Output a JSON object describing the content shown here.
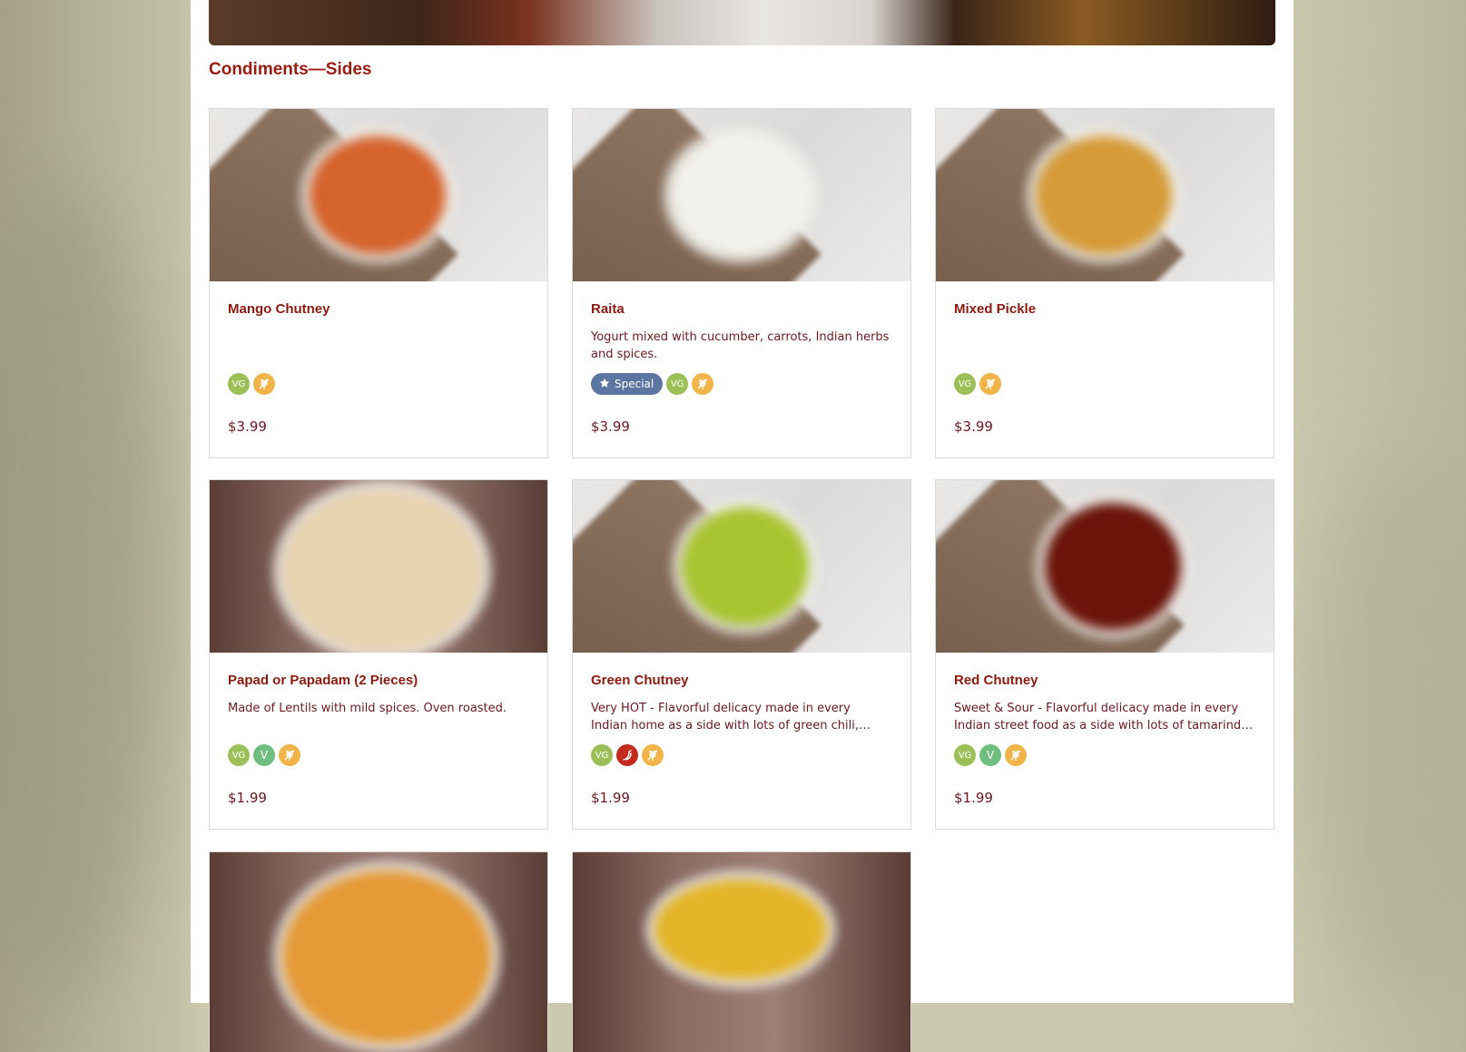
{
  "section": {
    "title": "Condiments—Sides"
  },
  "colors": {
    "accent": "#9a1c10",
    "text": "#6b1820",
    "special": "#5b76a1",
    "vegan": "#9cc057",
    "vegetarian": "#6fbe7f",
    "gluten_free": "#f0b449",
    "hot": "#c22a1e"
  },
  "special_badge": {
    "label": "Special",
    "icon": "star-icon"
  },
  "items": [
    {
      "name": "Mango Chutney",
      "description": "",
      "price": "$3.99",
      "badges": [
        {
          "type": "vg",
          "label": "VG",
          "icon": "vegan-icon"
        },
        {
          "type": "gf",
          "icon": "gluten-free-icon"
        }
      ],
      "image_color": "#d5632c"
    },
    {
      "name": "Raita",
      "description": "Yogurt mixed with cucumber, carrots, Indian herbs and spices.",
      "price": "$3.99",
      "special": true,
      "badges": [
        {
          "type": "vg",
          "label": "VG",
          "icon": "vegan-icon"
        },
        {
          "type": "gf",
          "icon": "gluten-free-icon"
        }
      ],
      "image_color": "#f2f2ec"
    },
    {
      "name": "Mixed Pickle",
      "description": "",
      "price": "$3.99",
      "badges": [
        {
          "type": "vg",
          "label": "VG",
          "icon": "vegan-icon"
        },
        {
          "type": "gf",
          "icon": "gluten-free-icon"
        }
      ],
      "image_color": "#d59b38"
    },
    {
      "name": "Papad or Papadam (2 Pieces)",
      "description": "Made of Lentils with mild spices. Oven roasted.",
      "price": "$1.99",
      "badges": [
        {
          "type": "vg",
          "label": "VG",
          "icon": "vegan-icon"
        },
        {
          "type": "v",
          "label": "V",
          "icon": "vegetarian-icon"
        },
        {
          "type": "gf",
          "icon": "gluten-free-icon"
        }
      ],
      "image_color": "#e8d3b0"
    },
    {
      "name": "Green Chutney",
      "description": "Very HOT - Flavorful delicacy made in every Indian home as a side with lots of green chili, cilantro and mint.",
      "price": "$1.99",
      "badges": [
        {
          "type": "vg",
          "label": "VG",
          "icon": "vegan-icon"
        },
        {
          "type": "hot",
          "icon": "chili-hot-icon"
        },
        {
          "type": "gf",
          "icon": "gluten-free-icon"
        }
      ],
      "image_color": "#a9c431"
    },
    {
      "name": "Red Chutney",
      "description": "Sweet & Sour - Flavorful delicacy made in every Indian street food as a side with lots of tamarind and dates.",
      "price": "$1.99",
      "badges": [
        {
          "type": "vg",
          "label": "VG",
          "icon": "vegan-icon"
        },
        {
          "type": "v",
          "label": "V",
          "icon": "vegetarian-icon"
        },
        {
          "type": "gf",
          "icon": "gluten-free-icon"
        }
      ],
      "image_color": "#6a140a"
    },
    {
      "name": "",
      "description": "",
      "price": "",
      "badges": [],
      "image_color": "#e49a36"
    },
    {
      "name": "",
      "description": "",
      "price": "",
      "badges": [],
      "image_color": "#e3b528"
    }
  ]
}
